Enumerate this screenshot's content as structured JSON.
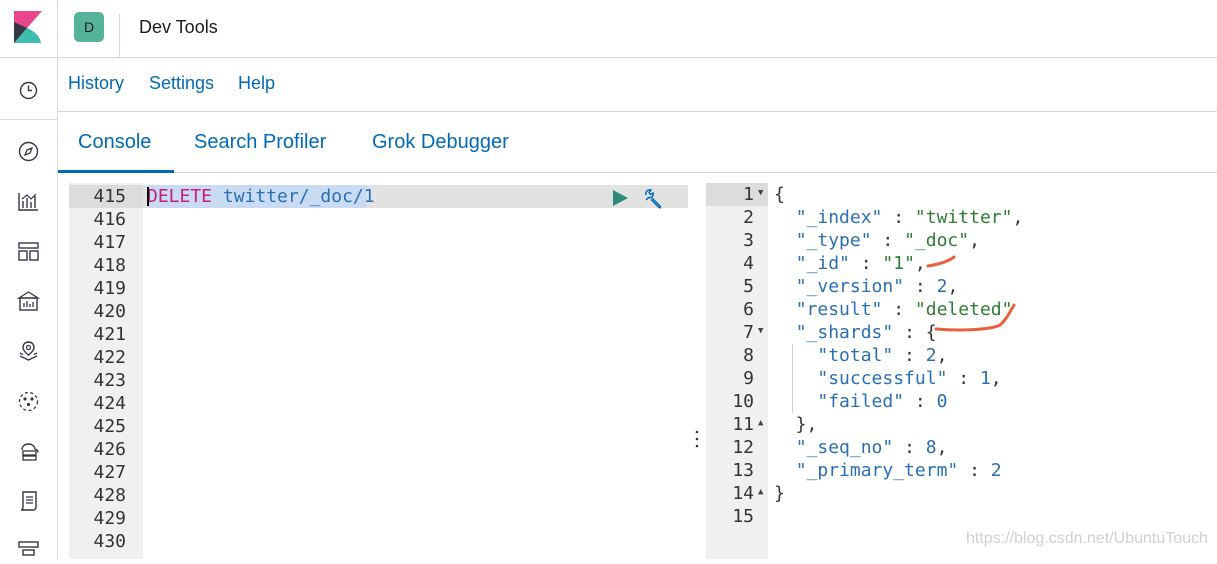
{
  "header": {
    "space_initial": "D",
    "app_title": "Dev Tools",
    "space_color": "#54b399"
  },
  "sidenav": {
    "items": [
      {
        "icon": "clock-icon"
      },
      {
        "icon": "compass-icon"
      },
      {
        "icon": "visualize-icon"
      },
      {
        "icon": "dashboard-icon"
      },
      {
        "icon": "canvas-icon"
      },
      {
        "icon": "maps-icon"
      },
      {
        "icon": "ml-icon"
      },
      {
        "icon": "infrastructure-icon"
      },
      {
        "icon": "logs-icon"
      },
      {
        "icon": "apm-icon"
      }
    ]
  },
  "topmenu": {
    "history": "History",
    "settings": "Settings",
    "help": "Help"
  },
  "tabs": {
    "console": "Console",
    "search_profiler": "Search Profiler",
    "grok_debugger": "Grok Debugger",
    "active": "Console"
  },
  "editor": {
    "line_numbers": [
      "415",
      "416",
      "417",
      "418",
      "419",
      "420",
      "421",
      "422",
      "423",
      "424",
      "425",
      "426",
      "427",
      "428",
      "429",
      "430"
    ],
    "method": "DELETE",
    "path": "twitter/_doc/1"
  },
  "output": {
    "line_numbers": [
      "1",
      "2",
      "3",
      "4",
      "5",
      "6",
      "7",
      "8",
      "9",
      "10",
      "11",
      "12",
      "13",
      "14",
      "15"
    ],
    "lines": [
      "{",
      "  \"_index\" : \"twitter\",",
      "  \"_type\" : \"_doc\",",
      "  \"_id\" : \"1\",",
      "  \"_version\" : 2,",
      "  \"result\" : \"deleted\"",
      "  \"_shards\" : {",
      "    \"total\" : 2,",
      "    \"successful\" : 1,",
      "    \"failed\" : 0",
      "  },",
      "  \"_seq_no\" : 8,",
      "  \"_primary_term\" : 2",
      "}",
      ""
    ]
  },
  "colors": {
    "link": "#006bb4",
    "method": "#c81e7a",
    "annotation": "#e8603c"
  },
  "watermark": "https://blog.csdn.net/UbuntuTouch"
}
